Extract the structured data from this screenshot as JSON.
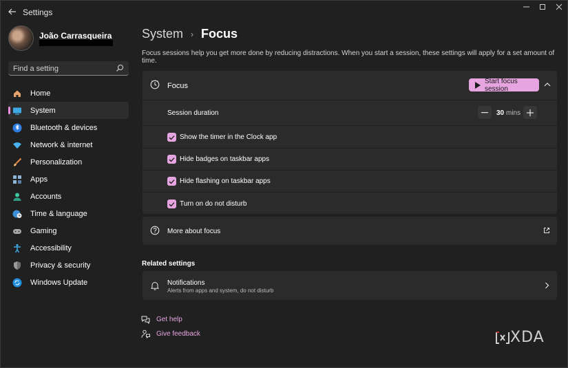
{
  "window": {
    "title": "Settings"
  },
  "profile": {
    "name": "João Carrasqueira"
  },
  "search": {
    "placeholder": "Find a setting"
  },
  "sidebar": {
    "items": [
      {
        "label": "Home",
        "icon": "home-icon"
      },
      {
        "label": "System",
        "icon": "system-icon",
        "active": true
      },
      {
        "label": "Bluetooth & devices",
        "icon": "bluetooth-icon"
      },
      {
        "label": "Network & internet",
        "icon": "wifi-icon"
      },
      {
        "label": "Personalization",
        "icon": "brush-icon"
      },
      {
        "label": "Apps",
        "icon": "apps-icon"
      },
      {
        "label": "Accounts",
        "icon": "person-icon"
      },
      {
        "label": "Time & language",
        "icon": "globe-clock-icon"
      },
      {
        "label": "Gaming",
        "icon": "controller-icon"
      },
      {
        "label": "Accessibility",
        "icon": "accessibility-icon"
      },
      {
        "label": "Privacy & security",
        "icon": "shield-icon"
      },
      {
        "label": "Windows Update",
        "icon": "update-icon"
      }
    ]
  },
  "breadcrumb": {
    "parent": "System",
    "separator": "›",
    "current": "Focus"
  },
  "page": {
    "description": "Focus sessions help you get more done by reducing distractions. When you start a session, these settings will apply for a set amount of time."
  },
  "focus": {
    "label": "Focus",
    "start_button": "Start focus session",
    "session_duration_label": "Session duration",
    "duration_value": "30",
    "duration_unit": "mins",
    "options": [
      {
        "label": "Show the timer in the Clock app",
        "checked": true
      },
      {
        "label": "Hide badges on taskbar apps",
        "checked": true
      },
      {
        "label": "Hide flashing on taskbar apps",
        "checked": true
      },
      {
        "label": "Turn on do not disturb",
        "checked": true
      }
    ]
  },
  "more_about": {
    "label": "More about focus"
  },
  "related": {
    "title": "Related settings",
    "notifications": {
      "label": "Notifications",
      "subtitle": "Alerts from apps and system, do not disturb"
    }
  },
  "links": {
    "get_help": "Get help",
    "give_feedback": "Give feedback"
  },
  "watermark": {
    "text": "XDA"
  },
  "colors": {
    "accent": "#e6a5e0",
    "background": "#202020",
    "card": "#2b2b2b"
  }
}
